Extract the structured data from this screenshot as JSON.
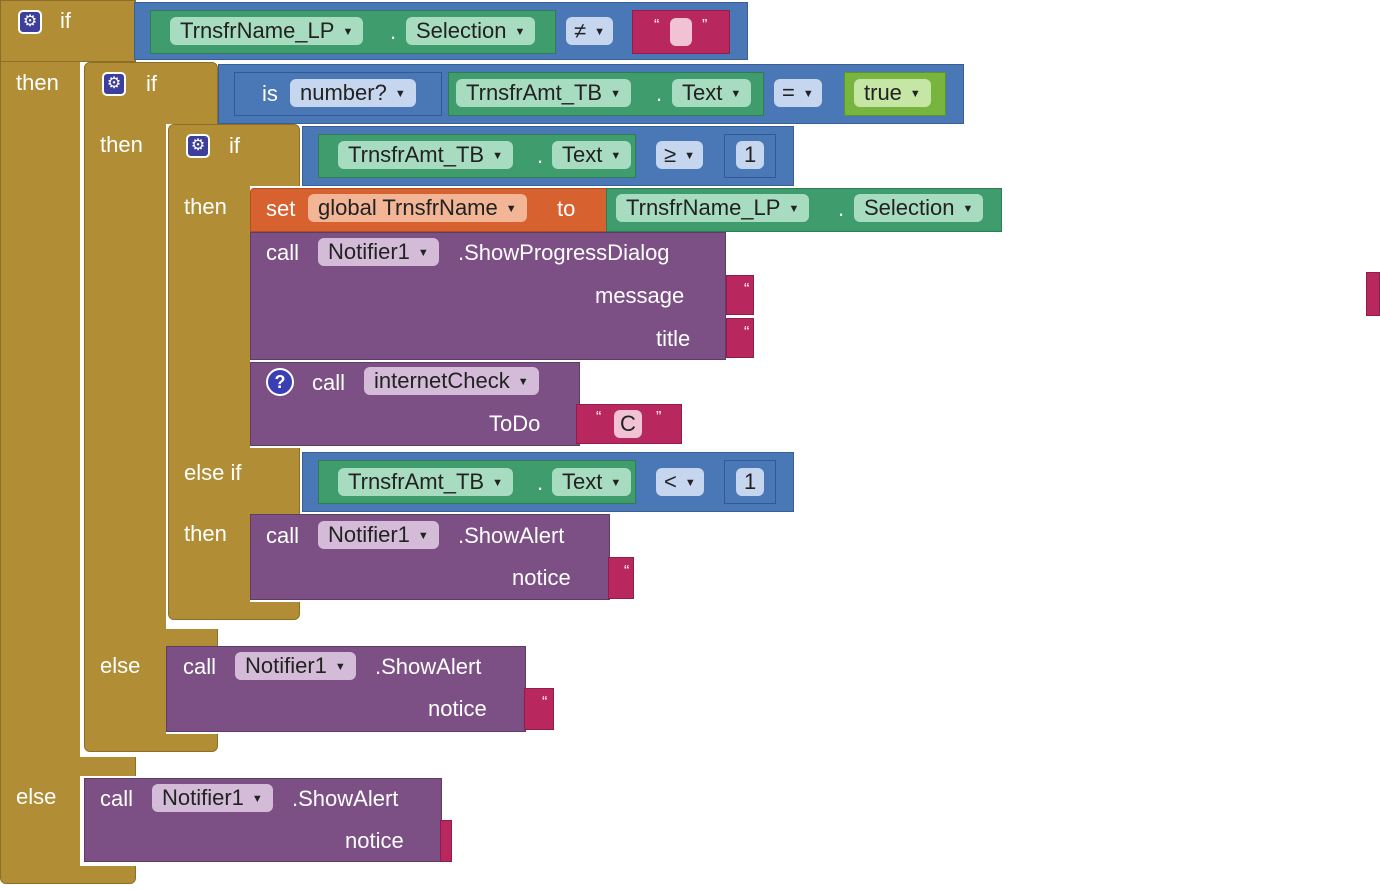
{
  "keywords": {
    "if": "if",
    "then": "then",
    "else": "else",
    "else_if": "else if",
    "call": "call",
    "set": "set",
    "to": "to",
    "is": "is",
    "dot": "."
  },
  "outer_if": {
    "component": "TrnsfrName_LP",
    "property": "Selection",
    "operator": "≠",
    "string_value": ""
  },
  "mid_if": {
    "predicate": "number?",
    "component": "TrnsfrAmt_TB",
    "property": "Text",
    "operator": "=",
    "value": "true"
  },
  "inner_if": {
    "component": "TrnsfrAmt_TB",
    "property": "Text",
    "operator": "≥",
    "number": "1"
  },
  "set_block": {
    "variable": "global TrnsfrName",
    "component": "TrnsfrName_LP",
    "property": "Selection"
  },
  "progress_dialog": {
    "component": "Notifier1",
    "method": ".ShowProgressDialog",
    "arg1": "message",
    "arg2": "title"
  },
  "internet_check": {
    "procedure": "internetCheck",
    "arg": "ToDo",
    "value": "C"
  },
  "else_if_cond": {
    "component": "TrnsfrAmt_TB",
    "property": "Text",
    "operator": "<",
    "number": "1"
  },
  "alert_inner": {
    "component": "Notifier1",
    "method": ".ShowAlert",
    "arg": "notice"
  },
  "alert_mid": {
    "component": "Notifier1",
    "method": ".ShowAlert",
    "arg": "notice"
  },
  "alert_outer": {
    "component": "Notifier1",
    "method": ".ShowAlert",
    "arg": "notice"
  },
  "colors": {
    "control": "#b18e35",
    "logic": "#4a78b7",
    "component": "#3f9c6c",
    "procedure_call": "#7c5085",
    "variable": "#d8622f",
    "text": "#b8285e",
    "boolean": "#78b53e"
  },
  "icons": {
    "mutator": "gear-icon",
    "help": "question-icon",
    "dropdown": "chevron-down-icon"
  }
}
